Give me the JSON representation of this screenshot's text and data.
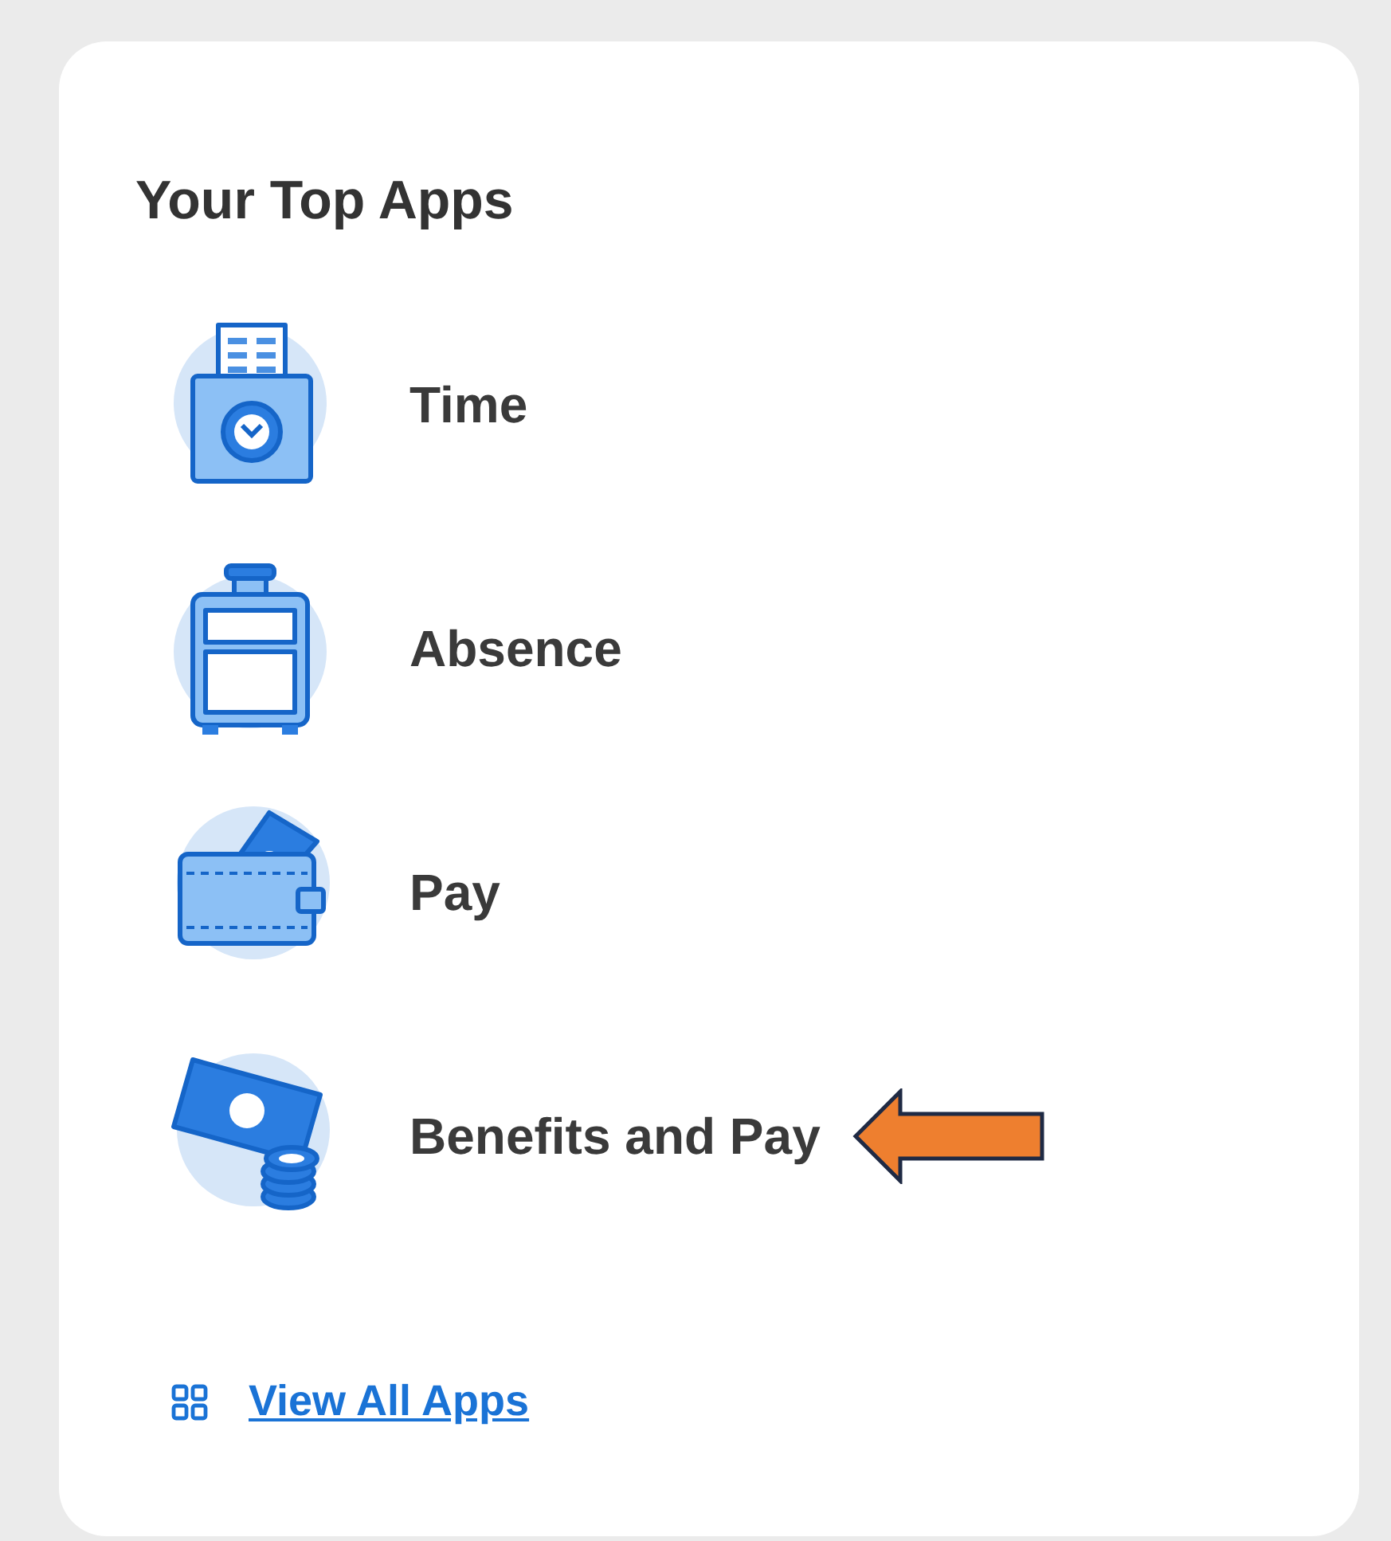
{
  "card": {
    "title": "Your Top Apps",
    "apps": [
      {
        "label": "Time",
        "kind": "clock",
        "highlighted": false
      },
      {
        "label": "Absence",
        "kind": "cabinet",
        "highlighted": false
      },
      {
        "label": "Pay",
        "kind": "wallet",
        "highlighted": false
      },
      {
        "label": "Benefits and Pay",
        "kind": "cash",
        "highlighted": true
      }
    ],
    "link": {
      "label": "View All Apps"
    }
  }
}
